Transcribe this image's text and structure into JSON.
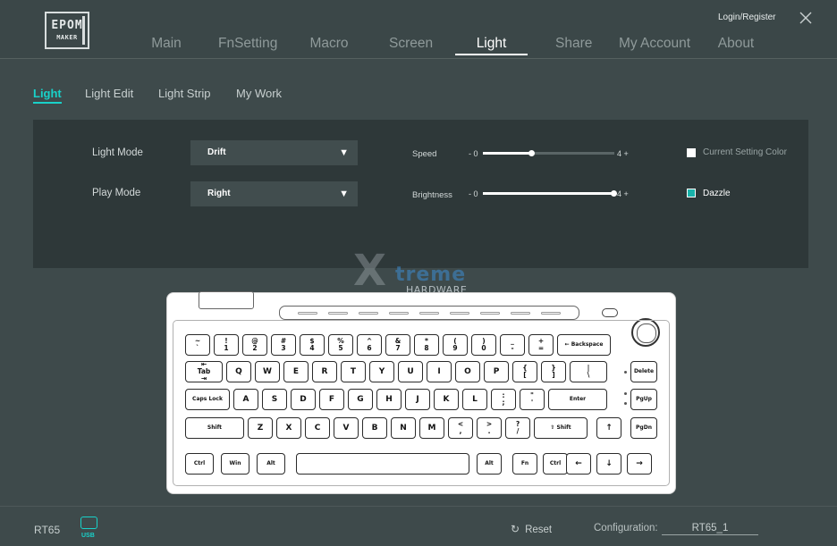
{
  "header": {
    "logo_text_top": "EPOM",
    "logo_text_bottom": "MAKER",
    "login_label": "Login/Register",
    "close_icon": "close-icon",
    "nav": [
      {
        "label": "Main",
        "active": false
      },
      {
        "label": "FnSetting",
        "active": false
      },
      {
        "label": "Macro",
        "active": false
      },
      {
        "label": "Screen",
        "active": false
      },
      {
        "label": "Light",
        "active": true
      },
      {
        "label": "Share",
        "active": false
      },
      {
        "label": "My Account",
        "active": false
      },
      {
        "label": "About",
        "active": false
      }
    ]
  },
  "subtabs": [
    {
      "label": "Light",
      "active": true
    },
    {
      "label": "Light Edit",
      "active": false
    },
    {
      "label": "Light Strip",
      "active": false
    },
    {
      "label": "My Work",
      "active": false
    }
  ],
  "settings": {
    "light_mode_label": "Light Mode",
    "light_mode_value": "Drift",
    "play_mode_label": "Play Mode",
    "play_mode_value": "Right",
    "dropdown_arrow": "▼",
    "speed_label": "Speed",
    "speed_min": "- 0",
    "speed_max": "4 +",
    "speed_value": 1.5,
    "brightness_label": "Brightness",
    "brightness_min": "- 0",
    "brightness_max": "4 +",
    "brightness_value": 4,
    "slider_max": 4,
    "current_setting_color_label": "Current Setting Color",
    "current_setting_color_checked": false,
    "dazzle_label": "Dazzle",
    "dazzle_checked": true
  },
  "watermark": {
    "mark": "X",
    "line1": "treme",
    "line2": "HARDWARE"
  },
  "keyboard": {
    "rows": [
      [
        "~\n`",
        "!\n1",
        "@\n2",
        "#\n3",
        "$\n4",
        "%\n5",
        "^\n6",
        "&\n7",
        "*\n8",
        "(\n9",
        ")\n0",
        "_\n-",
        "+\n=",
        "← Backspace"
      ],
      [
        "⇤\nTab\n⇥",
        "Q",
        "W",
        "E",
        "R",
        "T",
        "Y",
        "U",
        "I",
        "O",
        "P",
        "{\n[",
        "}\n]",
        "|\n\\",
        "Delete"
      ],
      [
        "Caps Lock",
        "A",
        "S",
        "D",
        "F",
        "G",
        "H",
        "J",
        "K",
        "L",
        ":\n;",
        "\"\n'",
        "Enter",
        "PgUp"
      ],
      [
        "Shift",
        "Z",
        "X",
        "C",
        "V",
        "B",
        "N",
        "M",
        "<\n,",
        ">\n.",
        "?\n/",
        "⇧ Shift",
        "↑",
        "PgDn"
      ],
      [
        "Ctrl",
        "Win",
        "Alt",
        "",
        "Alt",
        "Fn",
        "Ctrl",
        "←",
        "↓",
        "→"
      ]
    ]
  },
  "footer": {
    "model": "RT65",
    "usb_label": "USB",
    "reset_label": "Reset",
    "reset_icon": "↻",
    "configuration_label": "Configuration:",
    "configuration_value": "RT65_1"
  },
  "colors": {
    "accent": "#19d1c9",
    "background": "#3e4a4b",
    "panel": "#2e3839"
  }
}
